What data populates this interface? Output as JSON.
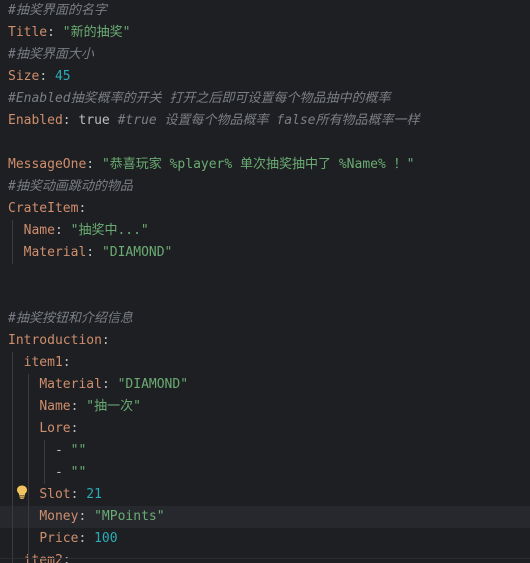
{
  "editor": {
    "lines": [
      {
        "parts": [
          {
            "t": "comment",
            "v": "#抽奖界面的名字"
          }
        ]
      },
      {
        "parts": [
          {
            "t": "key",
            "v": "Title"
          },
          {
            "t": "plain",
            "v": ": "
          },
          {
            "t": "str",
            "v": "\"新的抽奖\""
          }
        ]
      },
      {
        "parts": [
          {
            "t": "comment",
            "v": "#抽奖界面大小"
          }
        ]
      },
      {
        "parts": [
          {
            "t": "key",
            "v": "Size"
          },
          {
            "t": "plain",
            "v": ": "
          },
          {
            "t": "num",
            "v": "45"
          }
        ]
      },
      {
        "parts": [
          {
            "t": "comment",
            "v": "#Enabled抽奖概率的开关 打开之后即可设置每个物品抽中的概率"
          }
        ]
      },
      {
        "parts": [
          {
            "t": "key",
            "v": "Enabled"
          },
          {
            "t": "plain",
            "v": ": "
          },
          {
            "t": "bool",
            "v": "true"
          },
          {
            "t": "plain",
            "v": " "
          },
          {
            "t": "comment",
            "v": "#true 设置每个物品概率 false所有物品概率一样"
          }
        ]
      },
      {
        "parts": []
      },
      {
        "parts": [
          {
            "t": "key",
            "v": "MessageOne"
          },
          {
            "t": "plain",
            "v": ": "
          },
          {
            "t": "str",
            "v": "\"恭喜玩家 %player% 单次抽奖抽中了 %Name% ！\""
          }
        ]
      },
      {
        "parts": [
          {
            "t": "comment",
            "v": "#抽奖动画跳动的物品"
          }
        ]
      },
      {
        "parts": [
          {
            "t": "key",
            "v": "CrateItem"
          },
          {
            "t": "plain",
            "v": ":"
          }
        ]
      },
      {
        "parts": [
          {
            "t": "plain",
            "v": "  "
          },
          {
            "t": "key",
            "v": "Name"
          },
          {
            "t": "plain",
            "v": ": "
          },
          {
            "t": "str",
            "v": "\"抽奖中...\""
          }
        ]
      },
      {
        "parts": [
          {
            "t": "plain",
            "v": "  "
          },
          {
            "t": "key",
            "v": "Material"
          },
          {
            "t": "plain",
            "v": ": "
          },
          {
            "t": "str",
            "v": "\"DIAMOND\""
          }
        ]
      },
      {
        "parts": []
      },
      {
        "parts": []
      },
      {
        "parts": [
          {
            "t": "comment",
            "v": "#抽奖按钮和介绍信息"
          }
        ]
      },
      {
        "parts": [
          {
            "t": "key",
            "v": "Introduction"
          },
          {
            "t": "plain",
            "v": ":"
          }
        ]
      },
      {
        "parts": [
          {
            "t": "plain",
            "v": "  "
          },
          {
            "t": "key",
            "v": "item1"
          },
          {
            "t": "plain",
            "v": ":"
          }
        ]
      },
      {
        "parts": [
          {
            "t": "plain",
            "v": "    "
          },
          {
            "t": "key",
            "v": "Material"
          },
          {
            "t": "plain",
            "v": ": "
          },
          {
            "t": "str",
            "v": "\"DIAMOND\""
          }
        ]
      },
      {
        "parts": [
          {
            "t": "plain",
            "v": "    "
          },
          {
            "t": "key",
            "v": "Name"
          },
          {
            "t": "plain",
            "v": ": "
          },
          {
            "t": "str",
            "v": "\"抽一次\""
          }
        ]
      },
      {
        "parts": [
          {
            "t": "plain",
            "v": "    "
          },
          {
            "t": "key",
            "v": "Lore"
          },
          {
            "t": "plain",
            "v": ":"
          }
        ]
      },
      {
        "parts": [
          {
            "t": "plain",
            "v": "      - "
          },
          {
            "t": "str",
            "v": "\"\""
          }
        ]
      },
      {
        "parts": [
          {
            "t": "plain",
            "v": "      - "
          },
          {
            "t": "str",
            "v": "\"\""
          }
        ]
      },
      {
        "parts": [
          {
            "t": "plain",
            "v": "    "
          },
          {
            "t": "key",
            "v": "Slot"
          },
          {
            "t": "plain",
            "v": ": "
          },
          {
            "t": "num",
            "v": "21"
          }
        ]
      },
      {
        "current": true,
        "parts": [
          {
            "t": "plain",
            "v": "    "
          },
          {
            "t": "key",
            "v": "Money"
          },
          {
            "t": "plain",
            "v": ": "
          },
          {
            "t": "str",
            "v": "\"MPoints\""
          }
        ]
      },
      {
        "parts": [
          {
            "t": "plain",
            "v": "    "
          },
          {
            "t": "key",
            "v": "Price"
          },
          {
            "t": "plain",
            "v": ": "
          },
          {
            "t": "num",
            "v": "100"
          }
        ]
      },
      {
        "parts": [
          {
            "t": "plain",
            "v": "  "
          },
          {
            "t": "key",
            "v": "item2"
          },
          {
            "t": "plain",
            "v": ":"
          }
        ]
      }
    ]
  },
  "colors": {
    "background": "#1e1f22",
    "comment": "#7a7e85",
    "key": "#cf8e6d",
    "string": "#6aab73",
    "number": "#2aacb8",
    "plain": "#bcbec4",
    "current_line": "#26282e",
    "bulb": "#f2c55c"
  },
  "gutter": {
    "icon": "lightbulb-icon"
  }
}
